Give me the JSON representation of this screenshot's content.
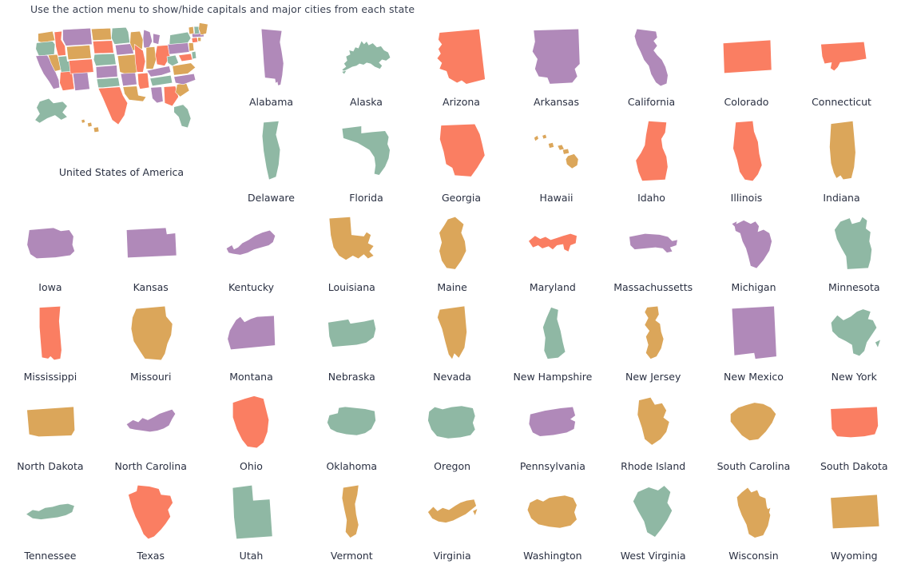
{
  "hint": "Use the action menu to show/hide capitals and major cities from each state",
  "palette": {
    "purple": "#b089b9",
    "green": "#8fb8a4",
    "coral": "#fa7e62",
    "gold": "#dba65a",
    "background": "#ffffff",
    "label_color": "#2a3042"
  },
  "usa": {
    "label": "United States of America"
  },
  "rows": [
    {
      "name": "row-1",
      "states": [
        {
          "name": "Alabama",
          "color": "#b089b9"
        },
        {
          "name": "Alaska",
          "color": "#8fb8a4"
        },
        {
          "name": "Arizona",
          "color": "#fa7e62"
        },
        {
          "name": "Arkansas",
          "color": "#b089b9"
        },
        {
          "name": "California",
          "color": "#b089b9"
        },
        {
          "name": "Colorado",
          "color": "#fa7e62"
        },
        {
          "name": "Connecticut",
          "color": "#fa7e62"
        }
      ]
    },
    {
      "name": "row-2",
      "states": [
        {
          "name": "Delaware",
          "color": "#8fb8a4"
        },
        {
          "name": "Florida",
          "color": "#8fb8a4"
        },
        {
          "name": "Georgia",
          "color": "#fa7e62"
        },
        {
          "name": "Hawaii",
          "color": "#dba65a"
        },
        {
          "name": "Idaho",
          "color": "#fa7e62"
        },
        {
          "name": "Illinois",
          "color": "#fa7e62"
        },
        {
          "name": "Indiana",
          "color": "#dba65a"
        }
      ]
    },
    {
      "name": "row-3",
      "states": [
        {
          "name": "Iowa",
          "color": "#b089b9"
        },
        {
          "name": "Kansas",
          "color": "#b089b9"
        },
        {
          "name": "Kentucky",
          "color": "#b089b9"
        },
        {
          "name": "Louisiana",
          "color": "#dba65a"
        },
        {
          "name": "Maine",
          "color": "#dba65a"
        },
        {
          "name": "Maryland",
          "color": "#fa7e62"
        },
        {
          "name": "Massachussetts",
          "color": "#b089b9"
        },
        {
          "name": "Michigan",
          "color": "#b089b9"
        },
        {
          "name": "Minnesota",
          "color": "#8fb8a4"
        }
      ]
    },
    {
      "name": "row-4",
      "states": [
        {
          "name": "Mississippi",
          "color": "#fa7e62"
        },
        {
          "name": "Missouri",
          "color": "#dba65a"
        },
        {
          "name": "Montana",
          "color": "#b089b9"
        },
        {
          "name": "Nebraska",
          "color": "#8fb8a4"
        },
        {
          "name": "Nevada",
          "color": "#dba65a"
        },
        {
          "name": "New Hampshire",
          "color": "#8fb8a4"
        },
        {
          "name": "New Jersey",
          "color": "#dba65a"
        },
        {
          "name": "New Mexico",
          "color": "#b089b9"
        },
        {
          "name": "New York",
          "color": "#8fb8a4"
        }
      ]
    },
    {
      "name": "row-5",
      "states": [
        {
          "name": "North Dakota",
          "color": "#dba65a"
        },
        {
          "name": "North Carolina",
          "color": "#b089b9"
        },
        {
          "name": "Ohio",
          "color": "#fa7e62"
        },
        {
          "name": "Oklahoma",
          "color": "#8fb8a4"
        },
        {
          "name": "Oregon",
          "color": "#8fb8a4"
        },
        {
          "name": "Pennsylvania",
          "color": "#b089b9"
        },
        {
          "name": "Rhode Island",
          "color": "#dba65a"
        },
        {
          "name": "South Carolina",
          "color": "#dba65a"
        },
        {
          "name": "South Dakota",
          "color": "#fa7e62"
        }
      ]
    },
    {
      "name": "row-6",
      "states": [
        {
          "name": "Tennessee",
          "color": "#8fb8a4"
        },
        {
          "name": "Texas",
          "color": "#fa7e62"
        },
        {
          "name": "Utah",
          "color": "#8fb8a4"
        },
        {
          "name": "Vermont",
          "color": "#dba65a"
        },
        {
          "name": "Virginia",
          "color": "#dba65a"
        },
        {
          "name": "Washington",
          "color": "#dba65a"
        },
        {
          "name": "West Virginia",
          "color": "#8fb8a4"
        },
        {
          "name": "Wisconsin",
          "color": "#dba65a"
        },
        {
          "name": "Wyoming",
          "color": "#dba65a"
        }
      ]
    }
  ],
  "usa_map_states": [
    {
      "name": "Washington",
      "color": "#dba65a"
    },
    {
      "name": "Oregon",
      "color": "#8fb8a4"
    },
    {
      "name": "California",
      "color": "#b089b9"
    },
    {
      "name": "Nevada",
      "color": "#dba65a"
    },
    {
      "name": "Idaho",
      "color": "#fa7e62"
    },
    {
      "name": "Montana",
      "color": "#b089b9"
    },
    {
      "name": "Wyoming",
      "color": "#dba65a"
    },
    {
      "name": "Utah",
      "color": "#8fb8a4"
    },
    {
      "name": "Arizona",
      "color": "#fa7e62"
    },
    {
      "name": "New Mexico",
      "color": "#b089b9"
    },
    {
      "name": "Colorado",
      "color": "#fa7e62"
    },
    {
      "name": "North Dakota",
      "color": "#dba65a"
    },
    {
      "name": "South Dakota",
      "color": "#fa7e62"
    },
    {
      "name": "Nebraska",
      "color": "#8fb8a4"
    },
    {
      "name": "Kansas",
      "color": "#b089b9"
    },
    {
      "name": "Oklahoma",
      "color": "#8fb8a4"
    },
    {
      "name": "Texas",
      "color": "#fa7e62"
    },
    {
      "name": "Minnesota",
      "color": "#8fb8a4"
    },
    {
      "name": "Iowa",
      "color": "#b089b9"
    },
    {
      "name": "Missouri",
      "color": "#dba65a"
    },
    {
      "name": "Arkansas",
      "color": "#b089b9"
    },
    {
      "name": "Louisiana",
      "color": "#dba65a"
    },
    {
      "name": "Wisconsin",
      "color": "#dba65a"
    },
    {
      "name": "Illinois",
      "color": "#fa7e62"
    },
    {
      "name": "Mississippi",
      "color": "#fa7e62"
    },
    {
      "name": "Michigan",
      "color": "#b089b9"
    },
    {
      "name": "Indiana",
      "color": "#dba65a"
    },
    {
      "name": "Ohio",
      "color": "#fa7e62"
    },
    {
      "name": "Kentucky",
      "color": "#b089b9"
    },
    {
      "name": "Tennessee",
      "color": "#8fb8a4"
    },
    {
      "name": "Alabama",
      "color": "#b089b9"
    },
    {
      "name": "Georgia",
      "color": "#fa7e62"
    },
    {
      "name": "Florida",
      "color": "#8fb8a4"
    },
    {
      "name": "South Carolina",
      "color": "#dba65a"
    },
    {
      "name": "North Carolina",
      "color": "#b089b9"
    },
    {
      "name": "Virginia",
      "color": "#dba65a"
    },
    {
      "name": "West Virginia",
      "color": "#8fb8a4"
    },
    {
      "name": "Maryland",
      "color": "#fa7e62"
    },
    {
      "name": "Delaware",
      "color": "#8fb8a4"
    },
    {
      "name": "Pennsylvania",
      "color": "#b089b9"
    },
    {
      "name": "New Jersey",
      "color": "#dba65a"
    },
    {
      "name": "New York",
      "color": "#8fb8a4"
    },
    {
      "name": "Connecticut",
      "color": "#fa7e62"
    },
    {
      "name": "Rhode Island",
      "color": "#dba65a"
    },
    {
      "name": "Massachussetts",
      "color": "#b089b9"
    },
    {
      "name": "Vermont",
      "color": "#dba65a"
    },
    {
      "name": "New Hampshire",
      "color": "#8fb8a4"
    },
    {
      "name": "Maine",
      "color": "#dba65a"
    },
    {
      "name": "Alaska",
      "color": "#8fb8a4"
    },
    {
      "name": "Hawaii",
      "color": "#dba65a"
    }
  ]
}
